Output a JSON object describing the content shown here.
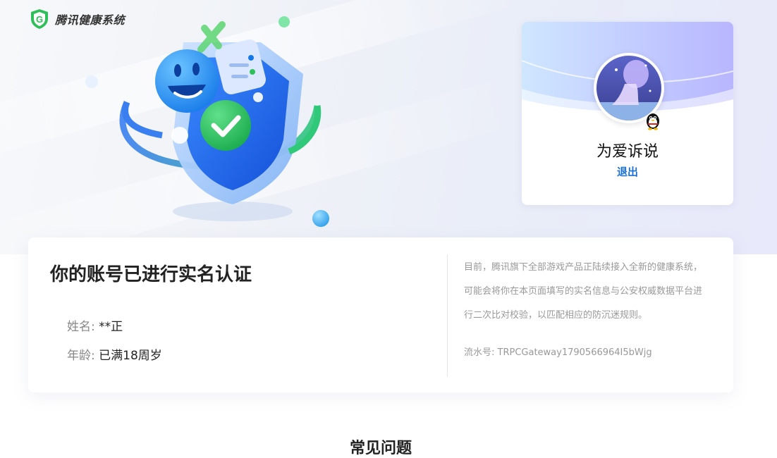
{
  "brand": {
    "name": "腾讯健康系统",
    "accent": "#1a6fd8",
    "green": "#2fbf5a"
  },
  "profile": {
    "nickname": "为爱诉说",
    "logout_label": "退出",
    "badge_icon": "qq-penguin-icon"
  },
  "verification": {
    "title": "你的账号已进行实名认证",
    "fields": [
      {
        "label": "姓名:",
        "value": "**正"
      },
      {
        "label": "年龄:",
        "value": "已满18周岁"
      }
    ],
    "notice": "目前，腾讯旗下全部游戏产品正陆续接入全新的健康系统，可能会将你在本页面填写的实名信息与公安权威数据平台进行二次比对校验，以匹配相应的防沉迷规则。",
    "serial_label": "流水号: ",
    "serial_value": "TRPCGateway1790566964I5bWjg"
  },
  "faq": {
    "title": "常见问题"
  }
}
